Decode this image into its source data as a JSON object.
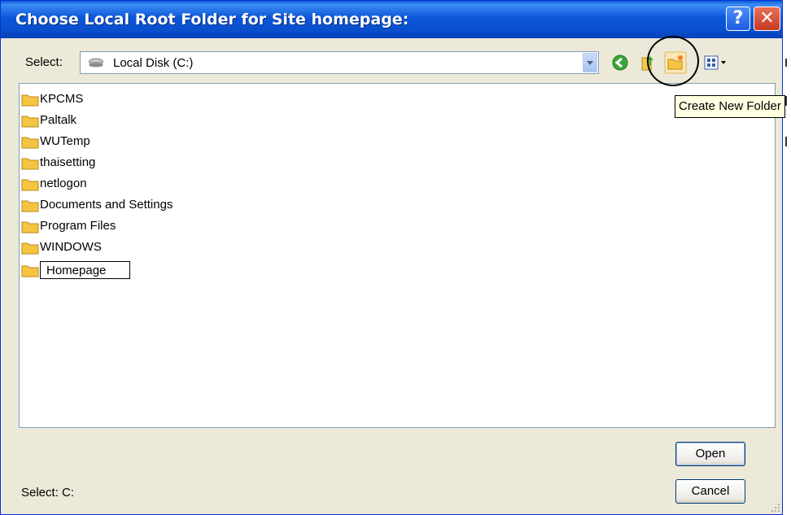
{
  "window": {
    "title": "Choose Local Root Folder for Site homepage:"
  },
  "titlebar": {
    "help_label": "?",
    "close_label": "✕"
  },
  "select_row": {
    "label": "Select:",
    "location": "Local Disk (C:)"
  },
  "toolbar": {
    "icons": [
      "back-icon",
      "up-folder-icon",
      "create-new-folder-icon",
      "view-menu-icon"
    ]
  },
  "tooltip": {
    "text": "Create New Folder"
  },
  "folders": [
    {
      "name": "KPCMS"
    },
    {
      "name": "Paltalk"
    },
    {
      "name": "WUTemp"
    },
    {
      "name": "thaisetting"
    },
    {
      "name": "netlogon"
    },
    {
      "name": "Documents and Settings"
    },
    {
      "name": "Program Files"
    },
    {
      "name": "WINDOWS"
    }
  ],
  "new_folder": {
    "name": "Homepage"
  },
  "buttons": {
    "open": "Open",
    "cancel": "Cancel"
  },
  "status": {
    "text": "Select: C:"
  },
  "colors": {
    "titlebar": "#0a55d6",
    "dialog_bg": "#ece9d8",
    "tooltip_bg": "#ffffe1",
    "folder": "#f5c542"
  }
}
